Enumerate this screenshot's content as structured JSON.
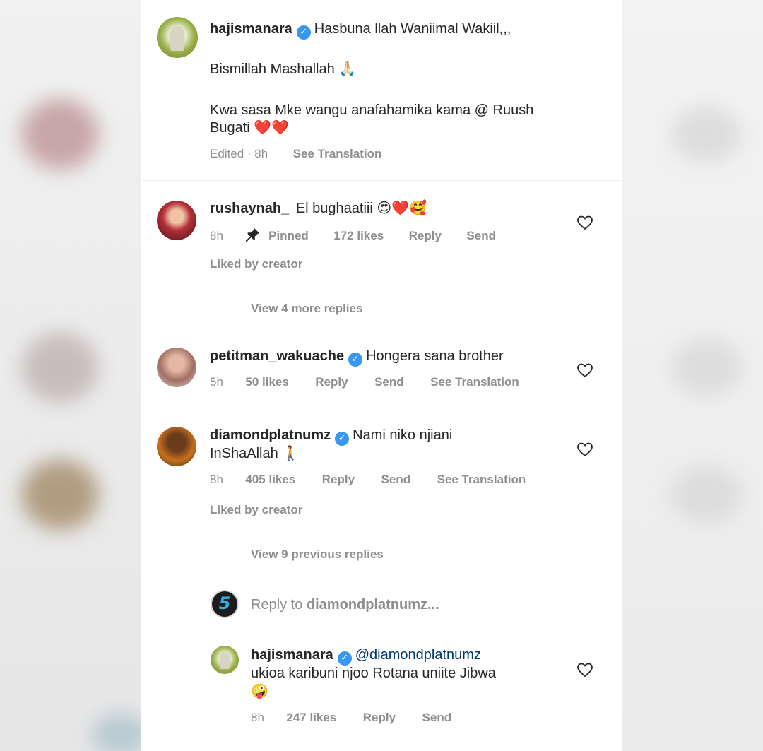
{
  "post": {
    "username": "hajismanara",
    "verified": true,
    "caption_line1": "Hasbuna llah Waniimal Wakiil,,,",
    "caption_line2": "Bismillah Mashallah 🙏🏻",
    "caption_line3": "Kwa sasa Mke wangu anafahamika kama @ Ruush",
    "caption_line4": "Bugati ❤️❤️",
    "meta_time": "Edited · 8h",
    "see_translation": "See Translation"
  },
  "comments": [
    {
      "username": "rushaynah_",
      "text": "El bughaatiii 😍❤️🥰",
      "time": "8h",
      "pinned": "Pinned",
      "likes": "172 likes",
      "reply": "Reply",
      "send": "Send",
      "liked_by": "Liked by creator",
      "view_replies": "View 4 more replies"
    },
    {
      "username": "petitman_wakuache",
      "verified": true,
      "text": "Hongera sana brother",
      "time": "5h",
      "likes": "50 likes",
      "reply": "Reply",
      "send": "Send",
      "see_translation": "See Translation"
    },
    {
      "username": "diamondplatnumz",
      "verified": true,
      "text_line1": "Nami niko njiani",
      "text_line2": "InShaAllah 🚶",
      "time": "8h",
      "likes": "405 likes",
      "reply": "Reply",
      "send": "Send",
      "see_translation": "See Translation",
      "liked_by": "Liked by creator",
      "view_replies": "View 9 previous replies"
    }
  ],
  "reply_box": {
    "prefix": "Reply to ",
    "target": "diamondplatnumz...",
    "avatar_label": "5"
  },
  "reply": {
    "username": "hajismanara",
    "verified": true,
    "mention": "@diamondplatnumz",
    "text_line1": "ukioa karibuni njoo Rotana  uniite Jibwa",
    "text_line2": "🤪",
    "time": "8h",
    "likes": "247 likes",
    "reply": "Reply",
    "send": "Send"
  },
  "colors": {
    "text": "#262626",
    "meta": "#8e8e8e",
    "verified": "#3897f0",
    "link": "#00376b"
  },
  "icons": [
    "verified-badge-icon",
    "pin-icon",
    "heart-outline-icon"
  ]
}
